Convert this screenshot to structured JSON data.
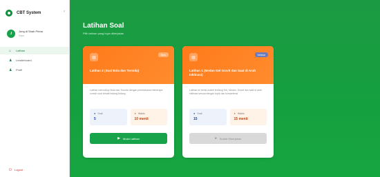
{
  "sidebar": {
    "brand": "CBT System",
    "toggle_icon": "‹",
    "user": {
      "initial": "J",
      "name": "Jung di Shah Prima",
      "role": "Guru"
    },
    "nav": [
      {
        "icon": "home",
        "glyph": "⌂",
        "label": "Latihan",
        "active": true
      },
      {
        "icon": "user-shield",
        "glyph": "♟",
        "label": "Leaderboard",
        "active": false
      },
      {
        "icon": "user",
        "glyph": "♟",
        "label": "Profil",
        "active": false
      }
    ],
    "logout": {
      "glyph": "⏻",
      "label": "Logout"
    }
  },
  "main": {
    "title": "Latihan Soal",
    "subtitle": "Pilih latihan yang ingin dikerjakan"
  },
  "cards": [
    {
      "icon": "book",
      "glyph": "▤",
      "badge": "Baru",
      "title": "Latihan 2 (Soal Bola dan Toroida)",
      "description": "Latihan mencakup Bola dan Toroida dengan pembahasan beberapa contoh soal terkait bidang-bidang",
      "soal_label": "Soal",
      "soal_value": "5",
      "waktu_label": "Waktu",
      "waktu_value": "10 menit",
      "button": "Mulai Latihan",
      "button_state": "enabled"
    },
    {
      "icon": "book",
      "glyph": "▤",
      "badge": "Selesai",
      "title": "Latihan 1 (Medan Gel Gravit dan Saat di Arah Inklinasi)",
      "description": "Latihan ini berisi materi tentang Gel, Medan, Gravit dan saat di arah inklinasi sesuai dengan topik dan kompetensi",
      "soal_label": "Soal",
      "soal_value": "15",
      "waktu_label": "Waktu",
      "waktu_value": "15 menit",
      "button": "Sudah Dikerjakan",
      "button_state": "disabled"
    }
  ],
  "colors": {
    "primary_green": "#16a34a",
    "card_orange": "#ff7a1a",
    "danger_red": "#e53935"
  }
}
